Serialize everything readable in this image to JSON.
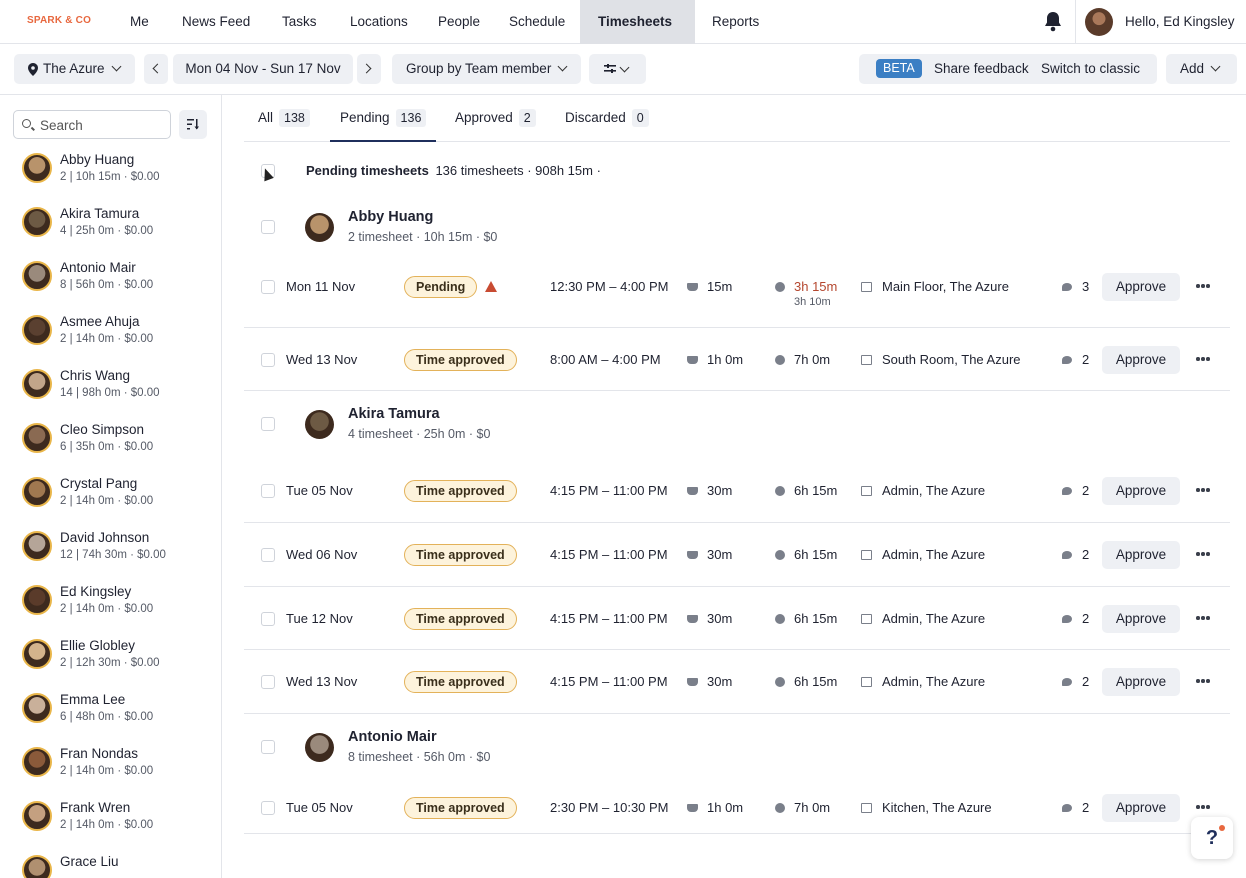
{
  "app": {
    "logo": "SPARK & CO"
  },
  "nav": {
    "items": [
      "Me",
      "News Feed",
      "Tasks",
      "Locations",
      "People",
      "Schedule",
      "Timesheets",
      "Reports"
    ],
    "active": "Timesheets",
    "greeting": "Hello, Ed Kingsley"
  },
  "toolbar": {
    "location": "The Azure",
    "date_range": "Mon 04 Nov - Sun 17 Nov",
    "group_by": "Group by Team member",
    "beta": "BETA",
    "share_feedback": "Share feedback",
    "switch_classic": "Switch to classic",
    "add": "Add"
  },
  "sidebar": {
    "search_placeholder": "Search",
    "employees": [
      {
        "name": "Abby Huang",
        "sub": "2 | 10h 15m · $0.00",
        "color": "#b8936b"
      },
      {
        "name": "Akira Tamura",
        "sub": "4 | 25h 0m · $0.00",
        "color": "#6d5a44"
      },
      {
        "name": "Antonio Mair",
        "sub": "8 | 56h 0m · $0.00",
        "color": "#9a8a7c"
      },
      {
        "name": "Asmee Ahuja",
        "sub": "2 | 14h 0m · $0.00",
        "color": "#5a4030"
      },
      {
        "name": "Chris Wang",
        "sub": "14 | 98h 0m · $0.00",
        "color": "#c2a58a"
      },
      {
        "name": "Cleo Simpson",
        "sub": "6 | 35h 0m · $0.00",
        "color": "#8a6a52"
      },
      {
        "name": "Crystal Pang",
        "sub": "2 | 14h 0m · $0.00",
        "color": "#a07850"
      },
      {
        "name": "David Johnson",
        "sub": "12 | 74h 30m · $0.00",
        "color": "#b5a598"
      },
      {
        "name": "Ed Kingsley",
        "sub": "2 | 14h 0m · $0.00",
        "color": "#5a3b2a"
      },
      {
        "name": "Ellie Globley",
        "sub": "2 | 12h 30m · $0.00",
        "color": "#d4b48c"
      },
      {
        "name": "Emma Lee",
        "sub": "6 | 48h 0m · $0.00",
        "color": "#c9b09a"
      },
      {
        "name": "Fran Nondas",
        "sub": "2 | 14h 0m · $0.00",
        "color": "#8a5a3a"
      },
      {
        "name": "Frank Wren",
        "sub": "2 | 14h 0m · $0.00",
        "color": "#c4a080"
      },
      {
        "name": "Grace Liu",
        "sub": "",
        "color": "#b09070"
      }
    ]
  },
  "tabs": [
    {
      "label": "All",
      "count": "138"
    },
    {
      "label": "Pending",
      "count": "136"
    },
    {
      "label": "Approved",
      "count": "2"
    },
    {
      "label": "Discarded",
      "count": "0"
    }
  ],
  "summary": {
    "title": "Pending timesheets",
    "detail": "136 timesheets · 908h 15m ·"
  },
  "groups": [
    {
      "name": "Abby Huang",
      "sub": "2 timesheet · 10h 15m · $0",
      "color": "#b8936b"
    },
    {
      "name": "Akira Tamura",
      "sub": "4 timesheet · 25h 0m · $0",
      "color": "#6d5a44"
    },
    {
      "name": "Antonio Mair",
      "sub": "8 timesheet · 56h 0m · $0",
      "color": "#9a8a7c"
    }
  ],
  "rows": [
    {
      "date": "Mon 11 Nov",
      "status": "Pending",
      "time": "12:30 PM – 4:00 PM",
      "break": "15m",
      "duration": "3h 15m",
      "duration_sub": "3h 10m",
      "area": "Main Floor, The Azure",
      "comments": "3",
      "approve": "Approve"
    },
    {
      "date": "Wed 13 Nov",
      "status": "Time approved",
      "time": "8:00 AM – 4:00 PM",
      "break": "1h 0m",
      "duration": "7h 0m",
      "area": "South Room, The Azure",
      "comments": "2",
      "approve": "Approve"
    },
    {
      "date": "Tue 05 Nov",
      "status": "Time approved",
      "time": "4:15 PM – 11:00 PM",
      "break": "30m",
      "duration": "6h 15m",
      "area": "Admin, The Azure",
      "comments": "2",
      "approve": "Approve"
    },
    {
      "date": "Wed 06 Nov",
      "status": "Time approved",
      "time": "4:15 PM – 11:00 PM",
      "break": "30m",
      "duration": "6h 15m",
      "area": "Admin, The Azure",
      "comments": "2",
      "approve": "Approve"
    },
    {
      "date": "Tue 12 Nov",
      "status": "Time approved",
      "time": "4:15 PM – 11:00 PM",
      "break": "30m",
      "duration": "6h 15m",
      "area": "Admin, The Azure",
      "comments": "2",
      "approve": "Approve"
    },
    {
      "date": "Wed 13 Nov",
      "status": "Time approved",
      "time": "4:15 PM – 11:00 PM",
      "break": "30m",
      "duration": "6h 15m",
      "area": "Admin, The Azure",
      "comments": "2",
      "approve": "Approve"
    },
    {
      "date": "Tue 05 Nov",
      "status": "Time approved",
      "time": "2:30 PM – 10:30 PM",
      "break": "1h 0m",
      "duration": "7h 0m",
      "area": "Kitchen, The Azure",
      "comments": "2",
      "approve": "Approve"
    }
  ],
  "help": "?"
}
